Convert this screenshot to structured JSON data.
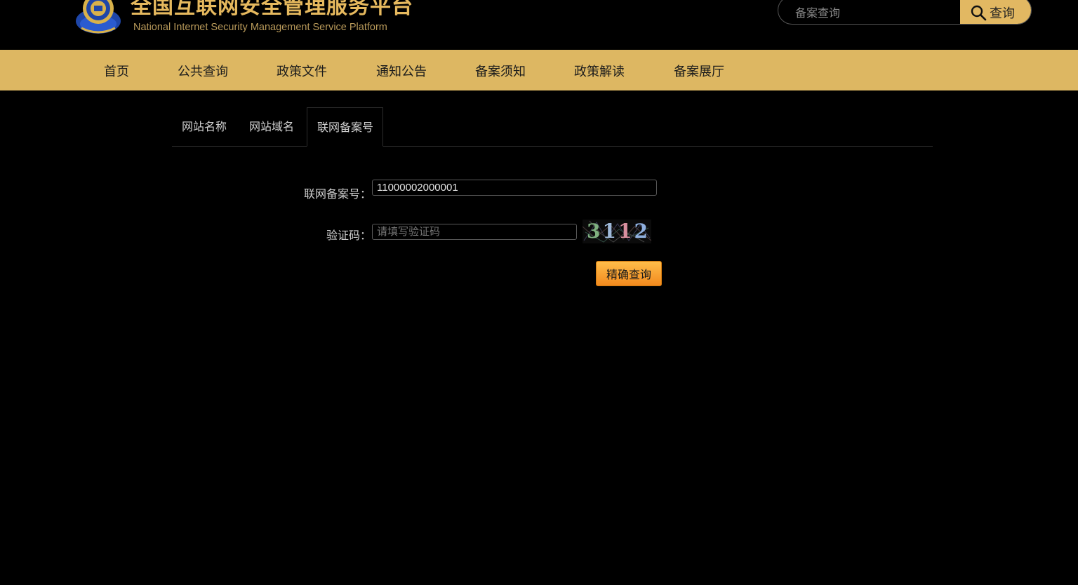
{
  "header": {
    "title": "全国互联网安全管理服务平台",
    "subtitle": "National Internet Security Management Service Platform",
    "logo_icon": "police-emblem-icon",
    "search_placeholder": "备案查询",
    "search_button_label": "查询"
  },
  "nav": {
    "items": [
      {
        "label": "首页"
      },
      {
        "label": "公共查询"
      },
      {
        "label": "政策文件"
      },
      {
        "label": "通知公告"
      },
      {
        "label": "备案须知"
      },
      {
        "label": "政策解读"
      },
      {
        "label": "备案展厅"
      }
    ]
  },
  "tabs": [
    {
      "label": "网站名称",
      "active": false
    },
    {
      "label": "网站域名",
      "active": false
    },
    {
      "label": "联网备案号",
      "active": true
    }
  ],
  "form": {
    "record_label": "联网备案号：",
    "record_value": "11000002000001",
    "captcha_label": "验证码：",
    "captcha_placeholder": "请填写验证码",
    "captcha_code": "3112",
    "submit_label": "精确查询"
  },
  "colors": {
    "background": "#000000",
    "accent_gold": "#ddb762",
    "title_gold": "#e6b95e",
    "button_orange": "#f5a030"
  }
}
